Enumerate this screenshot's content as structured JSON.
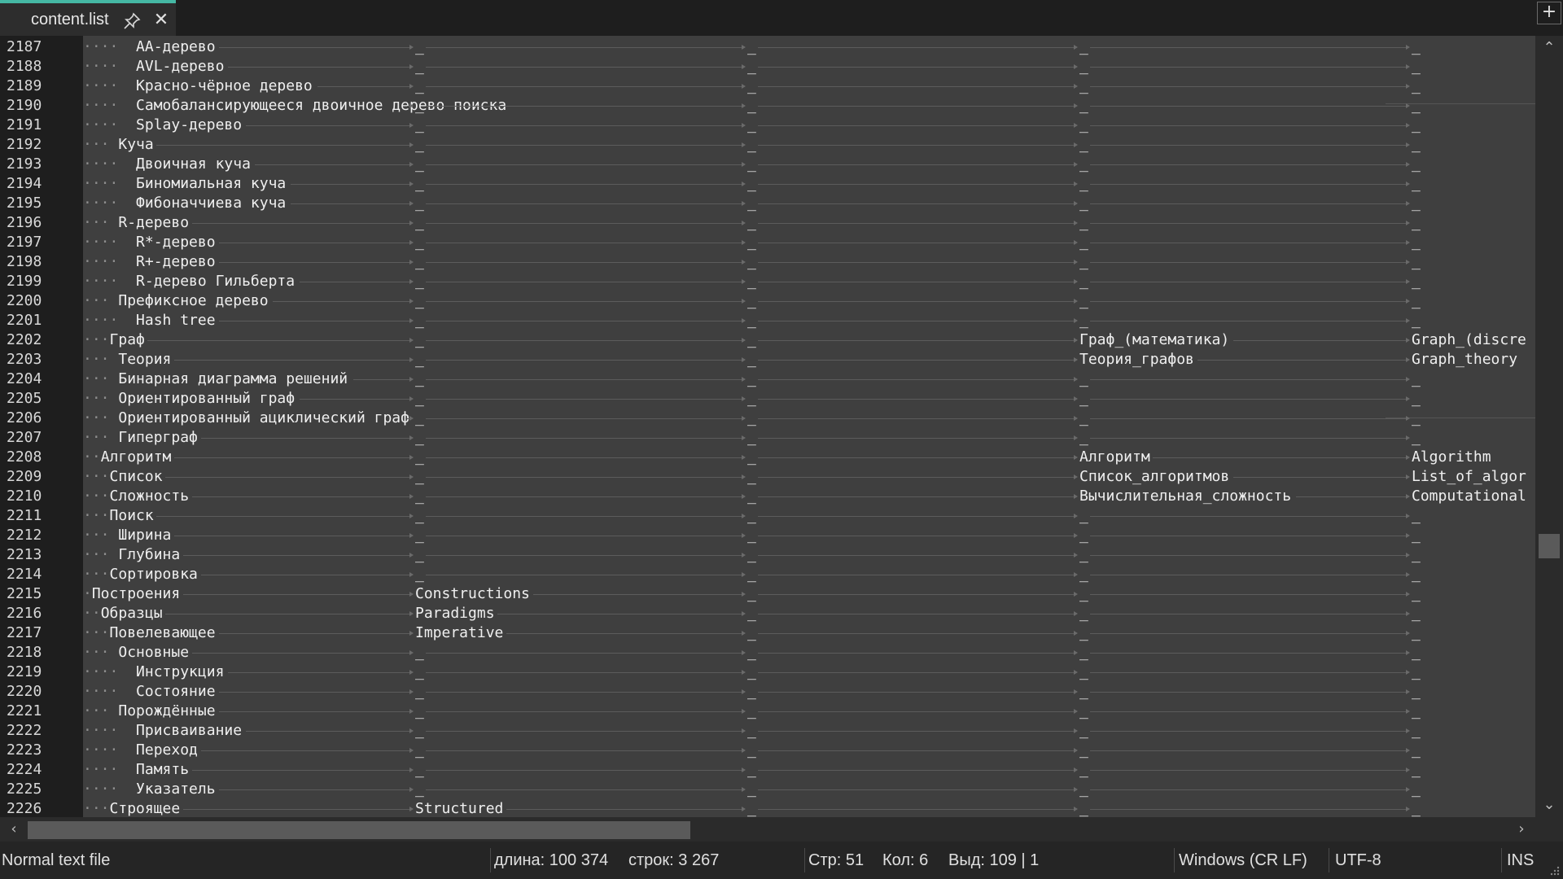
{
  "tab": {
    "title": "content.list"
  },
  "status": {
    "file_type": "Normal text file",
    "length": "длина: 100 374",
    "lines": "строк: 3 267",
    "row": "Стр: 51",
    "col": "Кол: 6",
    "sel": "Выд: 109 | 1",
    "eol": "Windows (CR LF)",
    "encoding": "UTF-8",
    "mode": "INS"
  },
  "rows": [
    {
      "n": "2187",
      "d": "····",
      "t": "  AA-дерево",
      "c2": "_",
      "c3": "_",
      "c4": "_",
      "c5": "_"
    },
    {
      "n": "2188",
      "d": "····",
      "t": "  AVL-дерево",
      "c2": "_",
      "c3": "_",
      "c4": "_",
      "c5": "_"
    },
    {
      "n": "2189",
      "d": "····",
      "t": "  Красно-чёрное дерево",
      "c2": "_",
      "c3": "_",
      "c4": "_",
      "c5": "_"
    },
    {
      "n": "2190",
      "d": "····",
      "t": "  Самобалансирующееся двоичное дерево поиска",
      "c2": "_",
      "c3": "_",
      "c4": "_",
      "c5": "_"
    },
    {
      "n": "2191",
      "d": "····",
      "t": "  Splay-дерево",
      "c2": "_",
      "c3": "_",
      "c4": "_",
      "c5": "_"
    },
    {
      "n": "2192",
      "d": "···",
      "t": " Куча",
      "c2": "_",
      "c3": "_",
      "c4": "_",
      "c5": "_"
    },
    {
      "n": "2193",
      "d": "····",
      "t": "  Двоичная куча",
      "c2": "_",
      "c3": "_",
      "c4": "_",
      "c5": "_"
    },
    {
      "n": "2194",
      "d": "····",
      "t": "  Биномиальная куча",
      "c2": "_",
      "c3": "_",
      "c4": "_",
      "c5": "_"
    },
    {
      "n": "2195",
      "d": "····",
      "t": "  Фибоначчиева куча",
      "c2": "_",
      "c3": "_",
      "c4": "_",
      "c5": "_"
    },
    {
      "n": "2196",
      "d": "···",
      "t": " R-дерево",
      "c2": "_",
      "c3": "_",
      "c4": "_",
      "c5": "_"
    },
    {
      "n": "2197",
      "d": "····",
      "t": "  R*-дерево",
      "c2": "_",
      "c3": "_",
      "c4": "_",
      "c5": "_"
    },
    {
      "n": "2198",
      "d": "····",
      "t": "  R+-дерево",
      "c2": "_",
      "c3": "_",
      "c4": "_",
      "c5": "_"
    },
    {
      "n": "2199",
      "d": "····",
      "t": "  R-дерево Гильберта",
      "c2": "_",
      "c3": "_",
      "c4": "_",
      "c5": "_"
    },
    {
      "n": "2200",
      "d": "···",
      "t": " Префиксное дерево",
      "c2": "_",
      "c3": "_",
      "c4": "_",
      "c5": "_"
    },
    {
      "n": "2201",
      "d": "····",
      "t": "  Hash tree",
      "c2": "_",
      "c3": "_",
      "c4": "_",
      "c5": "_"
    },
    {
      "n": "2202",
      "d": "···",
      "t": "Граф",
      "c2": "_",
      "c3": "_",
      "c4": "Граф_(математика)",
      "c5": "Graph_(discre"
    },
    {
      "n": "2203",
      "d": "···",
      "t": " Теория",
      "c2": "_",
      "c3": "_",
      "c4": "Теория_графов",
      "c5": "Graph_theory"
    },
    {
      "n": "2204",
      "d": "···",
      "t": " Бинарная диаграмма решений",
      "c2": "_",
      "c3": "_",
      "c4": "_",
      "c5": "_"
    },
    {
      "n": "2205",
      "d": "···",
      "t": " Ориентированный граф",
      "c2": "_",
      "c3": "_",
      "c4": "_",
      "c5": "_"
    },
    {
      "n": "2206",
      "d": "···",
      "t": " Ориентированный ациклический граф",
      "c2": "_",
      "c3": "_",
      "c4": "_",
      "c5": "_"
    },
    {
      "n": "2207",
      "d": "···",
      "t": " Гиперграф",
      "c2": "_",
      "c3": "_",
      "c4": "_",
      "c5": "_"
    },
    {
      "n": "2208",
      "d": "··",
      "t": "Алгоритм",
      "c2": "_",
      "c3": "_",
      "c4": "Алгоритм",
      "c5": "Algorithm"
    },
    {
      "n": "2209",
      "d": "···",
      "t": "Список",
      "c2": "_",
      "c3": "_",
      "c4": "Список_алгоритмов",
      "c5": "List_of_algor"
    },
    {
      "n": "2210",
      "d": "···",
      "t": "Сложность",
      "c2": "_",
      "c3": "_",
      "c4": "Вычислительная_сложность",
      "c5": "Computational"
    },
    {
      "n": "2211",
      "d": "···",
      "t": "Поиск",
      "c2": "_",
      "c3": "_",
      "c4": "_",
      "c5": "_"
    },
    {
      "n": "2212",
      "d": "···",
      "t": " Ширина",
      "c2": "_",
      "c3": "_",
      "c4": "_",
      "c5": "_"
    },
    {
      "n": "2213",
      "d": "···",
      "t": " Глубина",
      "c2": "_",
      "c3": "_",
      "c4": "_",
      "c5": "_"
    },
    {
      "n": "2214",
      "d": "···",
      "t": "Сортировка",
      "c2": "_",
      "c3": "_",
      "c4": "_",
      "c5": "_"
    },
    {
      "n": "2215",
      "d": "·",
      "t": "Построения",
      "c2": "Constructions",
      "c3": "_",
      "c4": "_",
      "c5": "_"
    },
    {
      "n": "2216",
      "d": "··",
      "t": "Образцы",
      "c2": "Paradigms",
      "c3": "_",
      "c4": "_",
      "c5": "_"
    },
    {
      "n": "2217",
      "d": "···",
      "t": "Повелевающее",
      "c2": "Imperative",
      "c3": "_",
      "c4": "_",
      "c5": "_"
    },
    {
      "n": "2218",
      "d": "···",
      "t": " Основные",
      "c2": "_",
      "c3": "_",
      "c4": "_",
      "c5": "_"
    },
    {
      "n": "2219",
      "d": "····",
      "t": "  Инструкция",
      "c2": "_",
      "c3": "_",
      "c4": "_",
      "c5": "_"
    },
    {
      "n": "2220",
      "d": "····",
      "t": "  Состояние",
      "c2": "_",
      "c3": "_",
      "c4": "_",
      "c5": "_"
    },
    {
      "n": "2221",
      "d": "···",
      "t": " Порождённые",
      "c2": "_",
      "c3": "_",
      "c4": "_",
      "c5": "_"
    },
    {
      "n": "2222",
      "d": "····",
      "t": "  Присваивание",
      "c2": "_",
      "c3": "_",
      "c4": "_",
      "c5": "_"
    },
    {
      "n": "2223",
      "d": "····",
      "t": "  Переход",
      "c2": "_",
      "c3": "_",
      "c4": "_",
      "c5": "_"
    },
    {
      "n": "2224",
      "d": "····",
      "t": "  Память",
      "c2": "_",
      "c3": "_",
      "c4": "_",
      "c5": "_"
    },
    {
      "n": "2225",
      "d": "····",
      "t": "  Указатель",
      "c2": "_",
      "c3": "_",
      "c4": "_",
      "c5": "_"
    },
    {
      "n": "2226",
      "d": "···",
      "t": "Строящее",
      "c2": "Structured",
      "c3": "_",
      "c4": "_",
      "c5": "_"
    }
  ]
}
